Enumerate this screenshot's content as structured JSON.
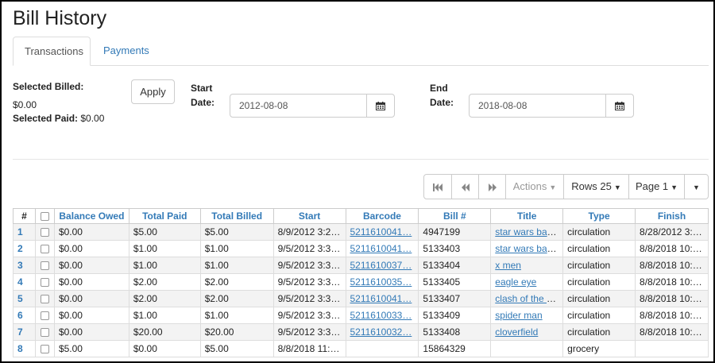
{
  "page": {
    "title": "Bill History"
  },
  "tabs": [
    {
      "label": "Transactions",
      "active": true
    },
    {
      "label": "Payments",
      "active": false
    }
  ],
  "summary": {
    "selected_billed_label": "Selected Billed:",
    "selected_billed_value": "$0.00",
    "selected_paid_label": "Selected Paid:",
    "selected_paid_value": "$0.00",
    "apply_label": "Apply"
  },
  "start_date": {
    "label_line1": "Start",
    "label_line2": "Date:",
    "value": "2012-08-08",
    "icon": "calendar-icon"
  },
  "end_date": {
    "label_line1": "End",
    "label_line2": "Date:",
    "value": "2018-08-08",
    "icon": "calendar-icon"
  },
  "toolbar": {
    "first_icon": "first-page-icon",
    "prev_icon": "previous-page-icon",
    "next_icon": "next-page-icon",
    "actions_label": "Actions",
    "rows_label": "Rows 25",
    "page_label": "Page 1",
    "more_icon": "caret-down-icon"
  },
  "table": {
    "columns": [
      "#",
      "",
      "Balance Owed",
      "Total Paid",
      "Total Billed",
      "Start",
      "Barcode",
      "Bill #",
      "Title",
      "Type",
      "Finish"
    ],
    "rows": [
      {
        "num": "1",
        "balance": "$0.00",
        "paid": "$5.00",
        "billed": "$5.00",
        "start": "8/9/2012 3:2…",
        "barcode": "5211610041…",
        "bill": "4947199",
        "title": "star wars batt…",
        "type": "circulation",
        "finish": "8/28/2012 3:…"
      },
      {
        "num": "2",
        "balance": "$0.00",
        "paid": "$1.00",
        "billed": "$1.00",
        "start": "9/5/2012 3:3…",
        "barcode": "5211610041…",
        "bill": "5133403",
        "title": "star wars batt…",
        "type": "circulation",
        "finish": "8/8/2018 10:…"
      },
      {
        "num": "3",
        "balance": "$0.00",
        "paid": "$1.00",
        "billed": "$1.00",
        "start": "9/5/2012 3:3…",
        "barcode": "5211610037…",
        "bill": "5133404",
        "title": "x men",
        "type": "circulation",
        "finish": "8/8/2018 10:…"
      },
      {
        "num": "4",
        "balance": "$0.00",
        "paid": "$2.00",
        "billed": "$2.00",
        "start": "9/5/2012 3:3…",
        "barcode": "5211610035…",
        "bill": "5133405",
        "title": "eagle eye",
        "type": "circulation",
        "finish": "8/8/2018 10:…"
      },
      {
        "num": "5",
        "balance": "$0.00",
        "paid": "$2.00",
        "billed": "$2.00",
        "start": "9/5/2012 3:3…",
        "barcode": "5211610041…",
        "bill": "5133407",
        "title": "clash of the ti…",
        "type": "circulation",
        "finish": "8/8/2018 10:…"
      },
      {
        "num": "6",
        "balance": "$0.00",
        "paid": "$1.00",
        "billed": "$1.00",
        "start": "9/5/2012 3:3…",
        "barcode": "5211610033…",
        "bill": "5133409",
        "title": "spider man",
        "type": "circulation",
        "finish": "8/8/2018 10:…"
      },
      {
        "num": "7",
        "balance": "$0.00",
        "paid": "$20.00",
        "billed": "$20.00",
        "start": "9/5/2012 3:3…",
        "barcode": "5211610032…",
        "bill": "5133408",
        "title": "cloverfield",
        "type": "circulation",
        "finish": "8/8/2018 10:…"
      },
      {
        "num": "8",
        "balance": "$5.00",
        "paid": "$0.00",
        "billed": "$5.00",
        "start": "8/8/2018 11:…",
        "barcode": "",
        "bill": "15864329",
        "title": "",
        "type": "grocery",
        "finish": ""
      }
    ]
  },
  "colors": {
    "link": "#337ab7",
    "border": "#cccccc",
    "stripe": "#f3f3f3"
  }
}
